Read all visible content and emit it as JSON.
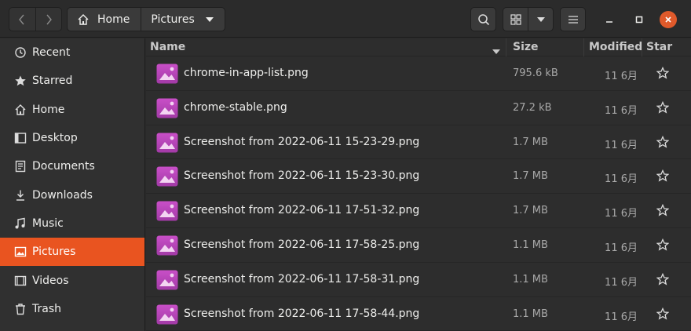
{
  "header": {
    "back_icon": "chevron-left-icon",
    "forward_icon": "chevron-right-icon",
    "breadcrumbs": [
      "Home",
      "Pictures"
    ],
    "search_icon": "search-icon",
    "view_icon": "grid-view-icon",
    "view_options_icon": "chevron-down-icon",
    "menu_icon": "hamburger-menu-icon",
    "minimize_icon": "minimize-icon",
    "maximize_icon": "maximize-icon",
    "close_icon": "close-icon",
    "accent": "#e95420"
  },
  "sidebar": {
    "items": [
      {
        "label": "Recent",
        "icon": "clock-icon"
      },
      {
        "label": "Starred",
        "icon": "star-icon"
      },
      {
        "label": "Home",
        "icon": "home-icon"
      },
      {
        "label": "Desktop",
        "icon": "desktop-icon"
      },
      {
        "label": "Documents",
        "icon": "document-icon"
      },
      {
        "label": "Downloads",
        "icon": "download-icon"
      },
      {
        "label": "Music",
        "icon": "music-icon"
      },
      {
        "label": "Pictures",
        "icon": "picture-icon",
        "active": true
      },
      {
        "label": "Videos",
        "icon": "video-icon"
      },
      {
        "label": "Trash",
        "icon": "trash-icon"
      }
    ]
  },
  "columns": {
    "name": "Name",
    "size": "Size",
    "modified": "Modified",
    "star": "Star"
  },
  "files": [
    {
      "name": "chrome-in-app-list.png",
      "size": "795.6 kB",
      "modified": "11 6月"
    },
    {
      "name": "chrome-stable.png",
      "size": "27.2 kB",
      "modified": "11 6月"
    },
    {
      "name": "Screenshot from 2022-06-11 15-23-29.png",
      "size": "1.7 MB",
      "modified": "11 6月"
    },
    {
      "name": "Screenshot from 2022-06-11 15-23-30.png",
      "size": "1.7 MB",
      "modified": "11 6月"
    },
    {
      "name": "Screenshot from 2022-06-11 17-51-32.png",
      "size": "1.7 MB",
      "modified": "11 6月"
    },
    {
      "name": "Screenshot from 2022-06-11 17-58-25.png",
      "size": "1.1 MB",
      "modified": "11 6月"
    },
    {
      "name": "Screenshot from 2022-06-11 17-58-31.png",
      "size": "1.1 MB",
      "modified": "11 6月"
    },
    {
      "name": "Screenshot from 2022-06-11 17-58-44.png",
      "size": "1.1 MB",
      "modified": "11 6月"
    }
  ]
}
